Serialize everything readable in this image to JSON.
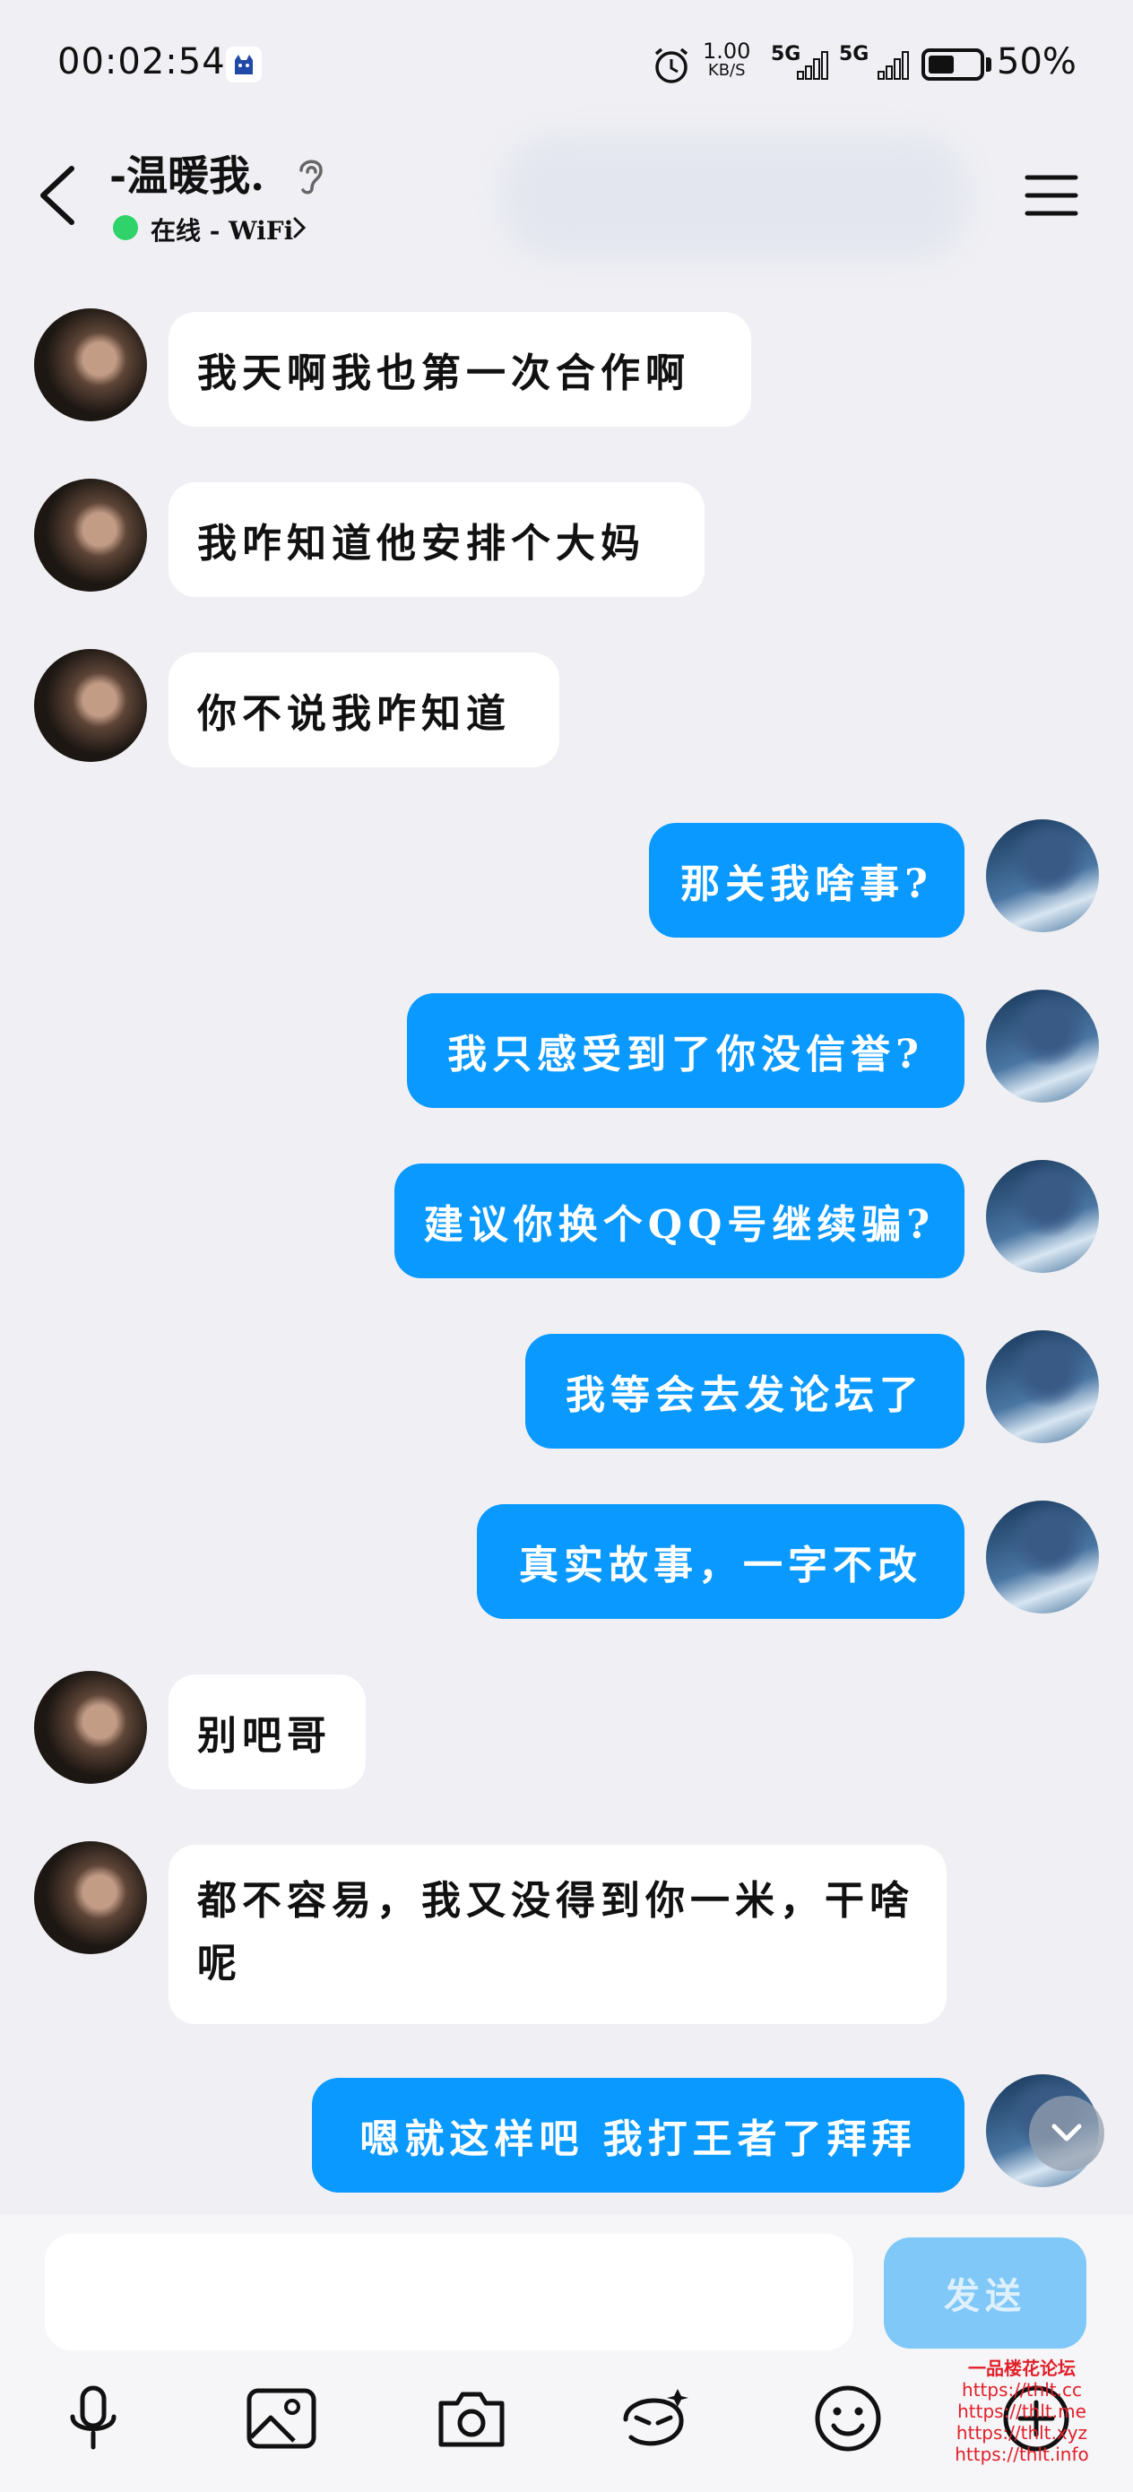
{
  "status_bar": {
    "time": "00:02:54",
    "speed_value": "1.00",
    "speed_unit": "KB/S",
    "net1": "5G",
    "net2": "5G",
    "battery": "50%"
  },
  "header": {
    "name": "-温暖我.",
    "online_status": "在线 - WiFi"
  },
  "messages": [
    {
      "side": "in",
      "text": "我天啊我也第一次合作啊"
    },
    {
      "side": "in",
      "text": "我咋知道他安排个大妈"
    },
    {
      "side": "in",
      "text": "你不说我咋知道"
    },
    {
      "side": "out",
      "text": "那关我啥事?"
    },
    {
      "side": "out",
      "text": "我只感受到了你没信誉?"
    },
    {
      "side": "out",
      "text": "建议你换个QQ号继续骗?"
    },
    {
      "side": "out",
      "text": "我等会去发论坛了"
    },
    {
      "side": "out",
      "text": "真实故事，一字不改"
    },
    {
      "side": "in",
      "text": "别吧哥"
    },
    {
      "side": "in",
      "text": "都不容易，我又没得到你一米，干啥呢"
    },
    {
      "side": "out",
      "text": "嗯就这样吧 我打王者了拜拜"
    }
  ],
  "composer": {
    "send_label": "发送",
    "input_value": ""
  },
  "toolbar_icons": [
    "microphone-icon",
    "image-icon",
    "camera-icon",
    "sticker-icon",
    "emoji-icon",
    "plus-icon"
  ],
  "watermark": {
    "title": "一品楼花论坛",
    "lines": [
      "https://thlt.cc",
      "https://thlt.me",
      "https://thlt.xyz",
      "https://thlt.info"
    ]
  },
  "colors": {
    "background": "#f0f0f4",
    "bubble_in": "#ffffff",
    "bubble_out": "#0a99ff",
    "send_disabled": "#7fc8f8",
    "online": "#2fd36a"
  }
}
